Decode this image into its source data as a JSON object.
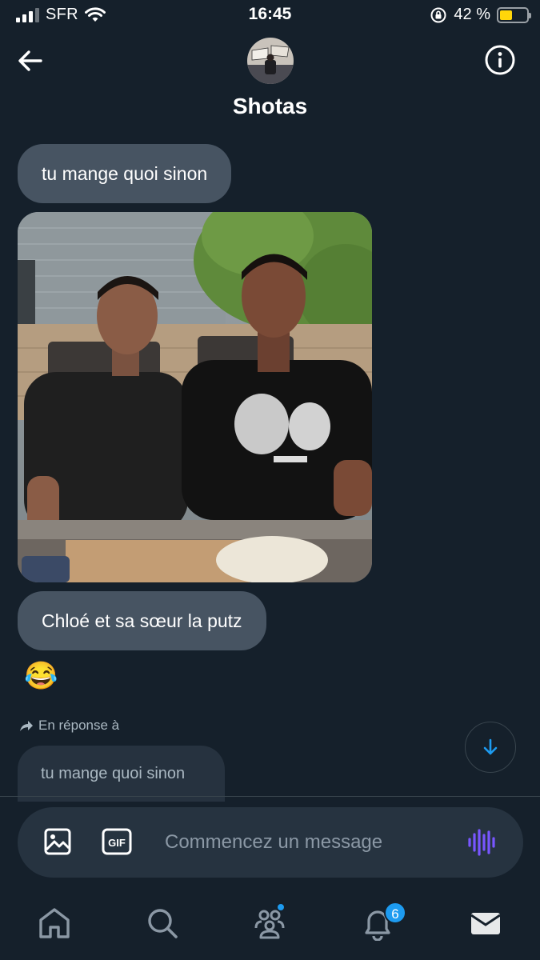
{
  "status_bar": {
    "carrier": "SFR",
    "time": "16:45",
    "battery_percent": "42 %",
    "battery_level": 0.42,
    "battery_color": "#ffd60a"
  },
  "header": {
    "back_icon": "arrow-left-icon",
    "title": "Shotas",
    "info_icon": "info-circle-icon"
  },
  "messages": [
    {
      "type": "text",
      "text": "tu mange quoi sinon"
    },
    {
      "type": "image",
      "description_icon": "photo-attachment"
    },
    {
      "type": "text",
      "text": "Chloé et sa sœur la putz"
    },
    {
      "type": "emoji",
      "text": "😂"
    }
  ],
  "reply": {
    "label": "En réponse à",
    "quoted_text": "tu mange quoi sinon"
  },
  "composer": {
    "placeholder": "Commencez un message",
    "image_icon": "image-icon",
    "gif_label": "GIF",
    "voice_icon": "voice-waveform-icon"
  },
  "tabbar": {
    "items": [
      {
        "icon": "home-icon"
      },
      {
        "icon": "search-icon"
      },
      {
        "icon": "communities-icon",
        "has_dot": true
      },
      {
        "icon": "bell-icon",
        "badge": "6"
      },
      {
        "icon": "mail-icon"
      }
    ]
  },
  "colors": {
    "background": "#15202b",
    "bubble": "#475462",
    "accent": "#1d9bf0",
    "voice": "#7856ff"
  }
}
